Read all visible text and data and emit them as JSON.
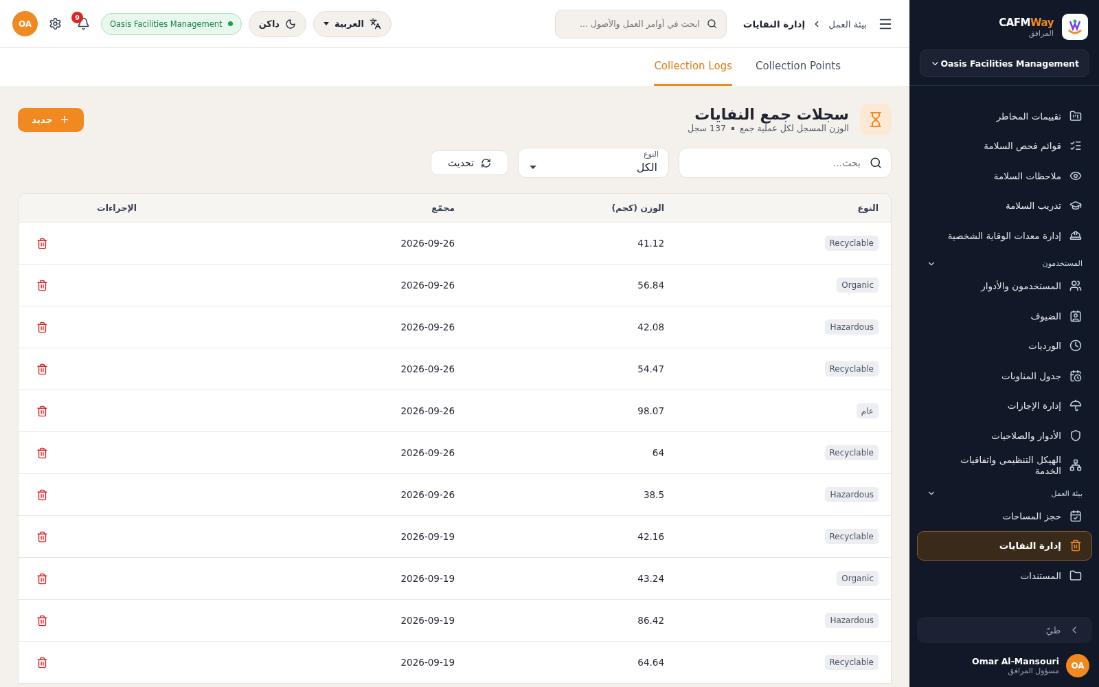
{
  "header": {
    "breadcrumb": [
      "بيئة العمل",
      "إدارة النفايات"
    ],
    "search": {
      "placeholder": "ابحث في أوامر العمل والأصول ..."
    },
    "language": "العربية",
    "theme": "داكن",
    "organization": "Oasis Facilities Management",
    "notifications": "9",
    "avatar": "OA"
  },
  "tabs": [
    {
      "label": "Collection Points",
      "selected": false
    },
    {
      "label": "Collection Logs",
      "selected": true
    }
  ],
  "page": {
    "title": "سجلات جمع النفايات",
    "subtitle": "الوزن المسجل لكل عملية جمع",
    "count": "137 سجل",
    "new_button": "جديد"
  },
  "filters": {
    "search": {
      "placeholder": "بحث..."
    },
    "type": {
      "label": "النوع",
      "value": "الكل"
    },
    "refresh": "تحديث"
  },
  "table": {
    "columns": [
      "النوع",
      "الوزن (كجم)",
      "مجمّع",
      "الإجراءات"
    ],
    "rows": [
      {
        "type": "Recyclable",
        "weight": "41.12",
        "date": "2026-09-26"
      },
      {
        "type": "Organic",
        "weight": "56.84",
        "date": "2026-09-26"
      },
      {
        "type": "Hazardous",
        "weight": "42.08",
        "date": "2026-09-26"
      },
      {
        "type": "Recyclable",
        "weight": "54.47",
        "date": "2026-09-26"
      },
      {
        "type": "عام",
        "weight": "98.07",
        "date": "2026-09-26"
      },
      {
        "type": "Recyclable",
        "weight": "64",
        "date": "2026-09-26"
      },
      {
        "type": "Hazardous",
        "weight": "38.5",
        "date": "2026-09-26"
      },
      {
        "type": "Recyclable",
        "weight": "42.16",
        "date": "2026-09-19"
      },
      {
        "type": "Organic",
        "weight": "43.24",
        "date": "2026-09-19"
      },
      {
        "type": "Hazardous",
        "weight": "86.42",
        "date": "2026-09-19"
      },
      {
        "type": "Recyclable",
        "weight": "64.64",
        "date": "2026-09-19"
      }
    ]
  },
  "sidebar": {
    "brand": "CAFM",
    "brand_accent": "Way",
    "brand_sub": "المرافق",
    "organization": "Oasis Facilities Management",
    "items": [
      {
        "label": "تقييمات المخاطر",
        "selected": false
      },
      {
        "label": "قوائم فحص السلامة",
        "selected": false
      },
      {
        "label": "ملاحظات السلامة",
        "selected": false
      },
      {
        "label": "تدريب السلامة",
        "selected": false
      },
      {
        "label": "إدارة معدات الوقاية الشخصية",
        "selected": false
      }
    ],
    "sections": [
      {
        "title": "المستخدمون",
        "expanded": true,
        "items": [
          {
            "label": "المستخدمون والأدوار",
            "selected": false
          },
          {
            "label": "الضيوف",
            "selected": false
          },
          {
            "label": "الورديات",
            "selected": false
          },
          {
            "label": "جدول المناوبات",
            "selected": false
          },
          {
            "label": "إدارة الإجازات",
            "selected": false
          },
          {
            "label": "الأدوار والصلاحيات",
            "selected": false
          },
          {
            "label": "الهيكل التنظيمي واتفاقيات الخدمة",
            "selected": false
          }
        ]
      },
      {
        "title": "بيئة العمل",
        "expanded": true,
        "items": [
          {
            "label": "حجز المساحات",
            "selected": false
          },
          {
            "label": "إدارة النفايات",
            "selected": true
          },
          {
            "label": "المستندات",
            "selected": false
          }
        ]
      }
    ],
    "collapse": "طيّ",
    "user": {
      "name": "Omar Al-Mansouri",
      "role": "مسؤول المرافق",
      "initials": "OA"
    }
  }
}
